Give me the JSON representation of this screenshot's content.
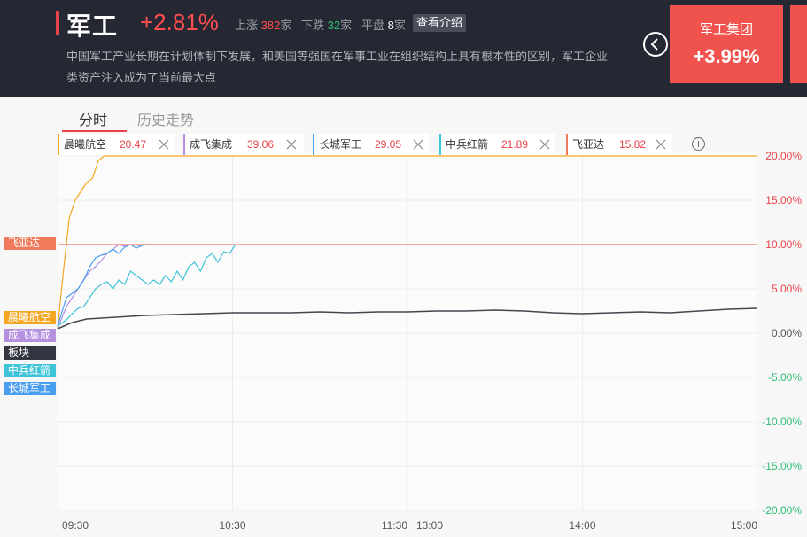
{
  "header": {
    "sector_name": "军工",
    "sector_change": "+2.81%",
    "stats": {
      "up_label": "上涨",
      "up_count": "382",
      "up_unit": "家",
      "down_label": "下跌",
      "down_count": "32",
      "down_unit": "家",
      "flat_label": "平盘",
      "flat_count": "8",
      "flat_unit": "家"
    },
    "intro_button": "查看介绍",
    "description": "中国军工产业长期在计划体制下发展，和美国等强国在军事工业在组织结构上具有根本性的区别，军工企业类资产注入成为了当前最大点",
    "top_card": {
      "name": "军工集团",
      "change": "+3.99%"
    }
  },
  "tabs": [
    {
      "label": "分时",
      "active": true
    },
    {
      "label": "历史走势",
      "active": false
    }
  ],
  "stocks": [
    {
      "name": "晨曦航空",
      "price": "20.47",
      "color": "#f5a623"
    },
    {
      "name": "成飞集成",
      "price": "39.06",
      "color": "#b58fe0"
    },
    {
      "name": "长城军工",
      "price": "29.05",
      "color": "#4a9ef0"
    },
    {
      "name": "中兵红箭",
      "price": "21.89",
      "color": "#3fc3d8"
    },
    {
      "name": "飞亚达",
      "price": "15.82",
      "color": "#ef7b5c"
    }
  ],
  "legend_tags": [
    {
      "label": "飞亚达",
      "color": "#ef7b5c"
    },
    {
      "label": "晨曦航空",
      "color": "#f5a623"
    },
    {
      "label": "成飞集成",
      "color": "#b58fe0"
    },
    {
      "label": "板块",
      "color": "#333640"
    },
    {
      "label": "中兵红箭",
      "color": "#3fc3d8"
    },
    {
      "label": "长城军工",
      "color": "#4a9ef0"
    }
  ],
  "chart_data": {
    "type": "line",
    "x_ticks": [
      "09:30",
      "10:30",
      "11:30",
      "13:00",
      "14:00",
      "15:00"
    ],
    "y_ticks": [
      "20.00%",
      "15.00%",
      "10.00%",
      "5.00%",
      "0.00%",
      "-5.00%",
      "-10.00%",
      "-15.00%",
      "-20.00%"
    ],
    "ylim": [
      -20,
      20
    ],
    "x_minutes_range": [
      0,
      240
    ],
    "colors": {
      "up": "#e8434a",
      "down": "#2fbd74",
      "flat": "#555555"
    },
    "series": [
      {
        "name": "晨曦航空",
        "color": "#f5a623",
        "x": [
          0,
          2,
          4,
          6,
          8,
          10,
          12,
          14,
          16,
          240
        ],
        "y": [
          0.5,
          7.0,
          13.0,
          15.0,
          16.0,
          17.0,
          17.5,
          19.5,
          20.0,
          20.0
        ]
      },
      {
        "name": "成飞集成",
        "color": "#b58fe0",
        "x": [
          0,
          3,
          5,
          7,
          9,
          11,
          13,
          15,
          17,
          19,
          21,
          23,
          25,
          28,
          30
        ],
        "y": [
          0.5,
          3.0,
          4.0,
          5.0,
          6.0,
          7.0,
          7.5,
          8.2,
          9.0,
          9.5,
          10.0,
          9.8,
          10.0,
          9.9,
          10.0
        ]
      },
      {
        "name": "长城军工",
        "color": "#4a9ef0",
        "x": [
          0,
          3,
          5,
          7,
          9,
          11,
          13,
          15,
          17,
          19,
          21,
          23,
          25,
          27,
          29,
          31,
          33
        ],
        "y": [
          0.8,
          4.0,
          4.5,
          5.0,
          6.0,
          7.5,
          8.5,
          8.8,
          9.0,
          9.5,
          9.0,
          9.7,
          10.0,
          9.6,
          9.9,
          10.0,
          10.0
        ]
      },
      {
        "name": "中兵红箭",
        "color": "#3fc3d8",
        "x": [
          0,
          3,
          5,
          7,
          9,
          11,
          13,
          15,
          17,
          19,
          21,
          23,
          25,
          27,
          29,
          31,
          33,
          35,
          37,
          39,
          41,
          43,
          45,
          47,
          49,
          51,
          53,
          55,
          57,
          59,
          61
        ],
        "y": [
          0.8,
          1.5,
          2.2,
          2.8,
          3.0,
          4.0,
          5.0,
          5.5,
          5.8,
          5.0,
          6.0,
          5.5,
          7.0,
          6.5,
          6.0,
          5.5,
          6.0,
          5.5,
          6.5,
          5.8,
          7.0,
          6.0,
          7.5,
          8.0,
          7.0,
          8.5,
          9.0,
          8.0,
          9.2,
          9.0,
          10.0
        ]
      },
      {
        "name": "板块",
        "color": "#444650",
        "x": [
          0,
          5,
          10,
          15,
          20,
          25,
          30,
          40,
          50,
          60,
          70,
          80,
          90,
          100,
          110,
          120,
          130,
          140,
          150,
          160,
          170,
          180,
          190,
          200,
          210,
          220,
          230,
          240
        ],
        "y": [
          0.5,
          1.2,
          1.6,
          1.7,
          1.8,
          1.9,
          2.0,
          2.1,
          2.2,
          2.3,
          2.3,
          2.3,
          2.4,
          2.3,
          2.4,
          2.4,
          2.5,
          2.5,
          2.6,
          2.5,
          2.3,
          2.2,
          2.3,
          2.4,
          2.3,
          2.5,
          2.7,
          2.8
        ]
      },
      {
        "name": "飞亚达",
        "color": "#ef7b5c",
        "x": [
          0,
          240
        ],
        "y": [
          10.0,
          10.0
        ]
      }
    ]
  }
}
